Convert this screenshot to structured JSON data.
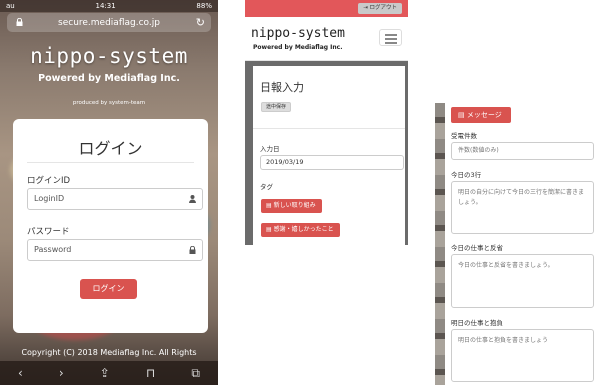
{
  "phone_login": {
    "status_bar": {
      "carrier": "au",
      "time": "14:31",
      "battery": "88%"
    },
    "url": "secure.mediaflag.co.jp",
    "brand": "nippo-system",
    "powered_by": "Powered by Mediaflag Inc.",
    "produced_by": "produced by system-team",
    "card": {
      "title": "ログイン",
      "login_id_label": "ログインID",
      "login_id_placeholder": "LoginID",
      "password_label": "パスワード",
      "password_placeholder": "Password",
      "submit_label": "ログイン"
    },
    "copyright": "Copyright (C) 2018 Mediaflag Inc. All Rights",
    "toolbar_icons": [
      "back-icon",
      "forward-icon",
      "share-icon",
      "bookmarks-icon",
      "tabs-icon"
    ]
  },
  "report_form": {
    "logout_label": "ログアウト",
    "brand": "nippo-system",
    "powered_by": "Powered by Mediaflag Inc.",
    "heading": "日報入力",
    "draft_badge": "途中保存",
    "date_label": "入力日",
    "date_value": "2019/03/19",
    "tag_label": "タグ",
    "tag_buttons": [
      "新しい取り組み",
      "感謝・嬉しかったこと"
    ]
  },
  "report_detail": {
    "message_button": "メッセージ",
    "fields": [
      {
        "label": "受電件数",
        "placeholder": "件数(数値のみ)"
      },
      {
        "label": "今日の3行",
        "placeholder": "明日の自分に向けて今日の三行を簡潔に書きましょう。"
      },
      {
        "label": "今日の仕事と反省",
        "placeholder": "今日の仕事と反省を書きましょう。"
      },
      {
        "label": "明日の仕事と抱負",
        "placeholder": "明日の仕事と抱負を書きましょう"
      }
    ]
  },
  "colors": {
    "accent": "#d9534f",
    "header_red": "#e2575a"
  }
}
